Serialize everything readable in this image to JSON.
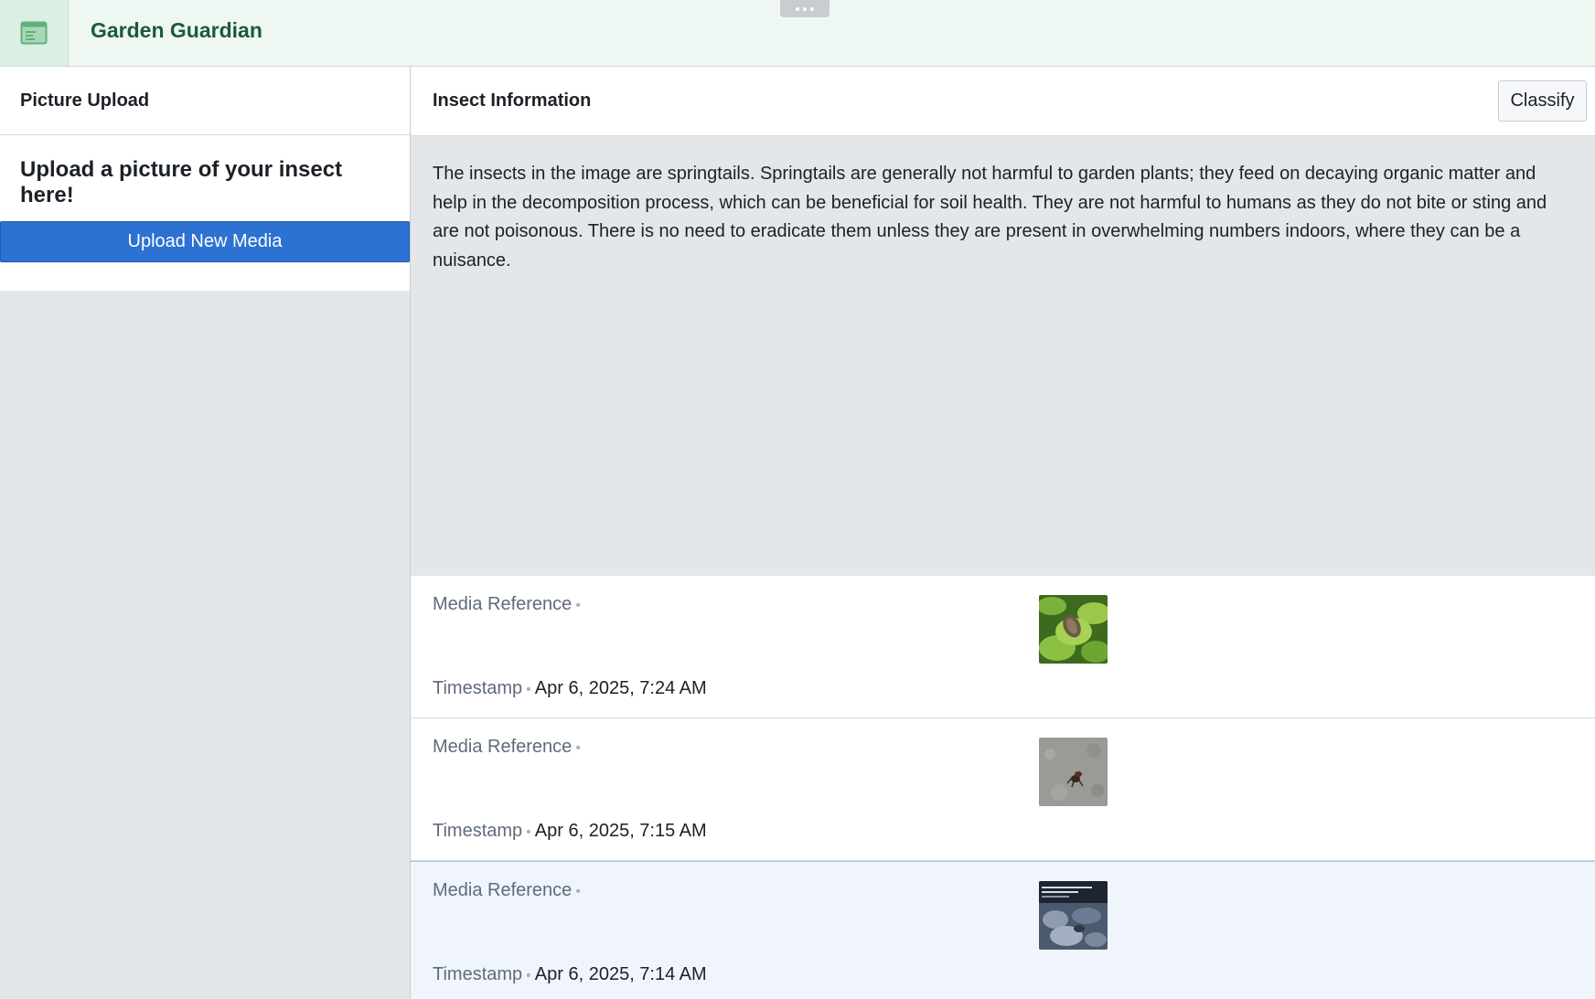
{
  "app": {
    "title": "Garden Guardian",
    "icon": "app-window-icon"
  },
  "left_panel": {
    "title": "Picture Upload",
    "heading": "Upload a picture of your insect here!",
    "upload_button_label": "Upload New Media"
  },
  "right_panel": {
    "title": "Insect Information",
    "classify_label": "Classify",
    "info_text": "The insects in the image are springtails. Springtails are generally not harmful to garden plants; they feed on decaying organic matter and help in the decomposition process, which can be beneficial for soil health. They are not harmful to humans as they do not bite or sting and are not poisonous. There is no need to eradicate them unless they are present in overwhelming numbers indoors, where they can be a nuisance."
  },
  "media": {
    "ref_label": "Media Reference",
    "ts_label": "Timestamp",
    "separator": "•",
    "rows": [
      {
        "timestamp": "Apr 6, 2025, 7:24 AM",
        "thumb": "insect-on-leaf-photo",
        "selected": false
      },
      {
        "timestamp": "Apr 6, 2025, 7:15 AM",
        "thumb": "bug-on-concrete-photo",
        "selected": false
      },
      {
        "timestamp": "Apr 6, 2025, 7:14 AM",
        "thumb": "screenshot-rocks-photo",
        "selected": true
      }
    ]
  },
  "colors": {
    "primary_button": "#2d72d2",
    "header_bg": "#eef7f1",
    "title_green": "#1d5a3a",
    "selected_row": "#f0f5fd"
  }
}
